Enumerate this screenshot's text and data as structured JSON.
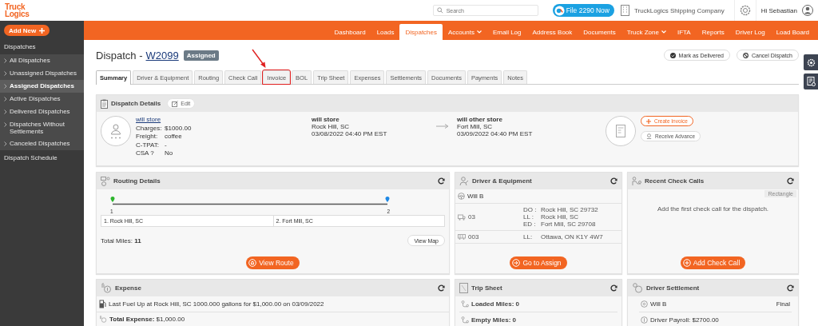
{
  "header": {
    "logo": [
      "Truck",
      "Logics"
    ],
    "search": {
      "placeholder": "Search"
    },
    "promo_button": "File 2290 Now",
    "company": "TruckLogics Shipping Company",
    "greeting": "Hi Sebastian"
  },
  "sidebar": {
    "add_button": "Add New",
    "section": "Dispatches",
    "items": [
      {
        "label": "All Dispatches",
        "selected": false
      },
      {
        "label": "Unassigned Dispatches",
        "selected": false
      },
      {
        "label": "Assigned Dispatches",
        "selected": true
      },
      {
        "label": "Active Dispatches",
        "selected": false
      },
      {
        "label": "Delivered Dispatches",
        "selected": false
      },
      {
        "label": "Dispatches Without Settlements",
        "selected": false
      },
      {
        "label": "Canceled Dispatches",
        "selected": false
      }
    ],
    "schedule": "Dispatch Schedule"
  },
  "nav": [
    {
      "label": "Dashboard",
      "selected": false,
      "has_menu": false
    },
    {
      "label": "Loads",
      "selected": false,
      "has_menu": false
    },
    {
      "label": "Dispatches",
      "selected": true,
      "has_menu": false
    },
    {
      "label": "Accounts",
      "selected": false,
      "has_menu": true
    },
    {
      "label": "Email Log",
      "selected": false,
      "has_menu": false
    },
    {
      "label": "Address Book",
      "selected": false,
      "has_menu": false
    },
    {
      "label": "Documents",
      "selected": false,
      "has_menu": false
    },
    {
      "label": "Truck Zone",
      "selected": false,
      "has_menu": true
    },
    {
      "label": "IFTA",
      "selected": false,
      "has_menu": false
    },
    {
      "label": "Reports",
      "selected": false,
      "has_menu": false
    },
    {
      "label": "Driver Log",
      "selected": false,
      "has_menu": false
    },
    {
      "label": "Load Board",
      "selected": false,
      "has_menu": false
    }
  ],
  "title": {
    "prefix": "Dispatch -",
    "number": "W2099",
    "status": "Assigned"
  },
  "actions": [
    {
      "kind": "check",
      "label": "Mark as Delivered"
    },
    {
      "kind": "cancel",
      "label": "Cancel Dispatch"
    }
  ],
  "tabs": [
    {
      "label": "Summary",
      "selected": true,
      "annotated": false
    },
    {
      "label": "Driver & Equipment",
      "selected": false,
      "annotated": false
    },
    {
      "label": "Routing",
      "selected": false,
      "annotated": false
    },
    {
      "label": "Check Call",
      "selected": false,
      "annotated": false
    },
    {
      "label": "Invoice",
      "selected": false,
      "annotated": true
    },
    {
      "label": "BOL",
      "selected": false,
      "annotated": false
    },
    {
      "label": "Trip Sheet",
      "selected": false,
      "annotated": false
    },
    {
      "label": "Expenses",
      "selected": false,
      "annotated": false
    },
    {
      "label": "Settlements",
      "selected": false,
      "annotated": false
    },
    {
      "label": "Documents",
      "selected": false,
      "annotated": false
    },
    {
      "label": "Payments",
      "selected": false,
      "annotated": false
    },
    {
      "label": "Notes",
      "selected": false,
      "annotated": false
    }
  ],
  "dispatch_details": {
    "title": "Dispatch Details",
    "edit_button": "Edit",
    "customer": "will store",
    "fields": [
      {
        "label": "Charges:",
        "value": "$1000.00"
      },
      {
        "label": "Freight:",
        "value": "coffee"
      },
      {
        "label": "C-TPAT:",
        "value": "-"
      },
      {
        "label": "CSA ?",
        "value": "No"
      }
    ],
    "pickup": [
      "will store",
      "Rock Hill, SC",
      "03/08/2022 04:40 PM EST"
    ],
    "delivery": [
      "will other store",
      "Fort Mill, SC",
      "03/09/2022 04:40 PM EST"
    ],
    "create_invoice": "Create Invoice",
    "receive_advance": "Receive Advance"
  },
  "routing": {
    "title": "Routing Details",
    "pins": [
      "1",
      "2"
    ],
    "stops": [
      "1. Rock Hill, SC",
      "2. Fort Mill, SC"
    ],
    "miles_label": "Total Miles:",
    "miles": "11",
    "map_button": "View Map",
    "route_button": "View Route"
  },
  "driver_equipment": {
    "title": "Driver & Equipment",
    "driver": "Will B",
    "truck": "03",
    "truck_lines": [
      {
        "label": "DO :",
        "value": "Rock Hill, SC 29732"
      },
      {
        "label": "LL :",
        "value": "Rock Hill, SC"
      },
      {
        "label": "ED :",
        "value": "Fort Mill, SC 29708"
      }
    ],
    "trailer": "003",
    "trailer_lines": [
      {
        "label": "LL:",
        "value": "Ottawa, ON K1Y 4W7"
      }
    ],
    "button": "Go to Assign"
  },
  "check_calls": {
    "title": "Recent Check Calls",
    "tag": "Rectangle",
    "message": "Add the first check call for the dispatch.",
    "button": "Add Check Call"
  },
  "expense": {
    "title": "Expense",
    "fuel": "Last Fuel Up at Rock Hill, SC 1000.000 gallons for $1,000.00 on 03/09/2022",
    "total_label": "Total Expense:",
    "total": "$1,000.00"
  },
  "trip_sheet": {
    "title": "Trip Sheet",
    "rows": [
      {
        "label": "Loaded Miles:",
        "value": "0"
      },
      {
        "label": "Empty Miles:",
        "value": "0"
      }
    ]
  },
  "settlement": {
    "title": "Driver Settlement",
    "driver": "Will B",
    "status": "Final",
    "payroll_label": "Driver Payroll:",
    "payroll": "$2700.00"
  }
}
